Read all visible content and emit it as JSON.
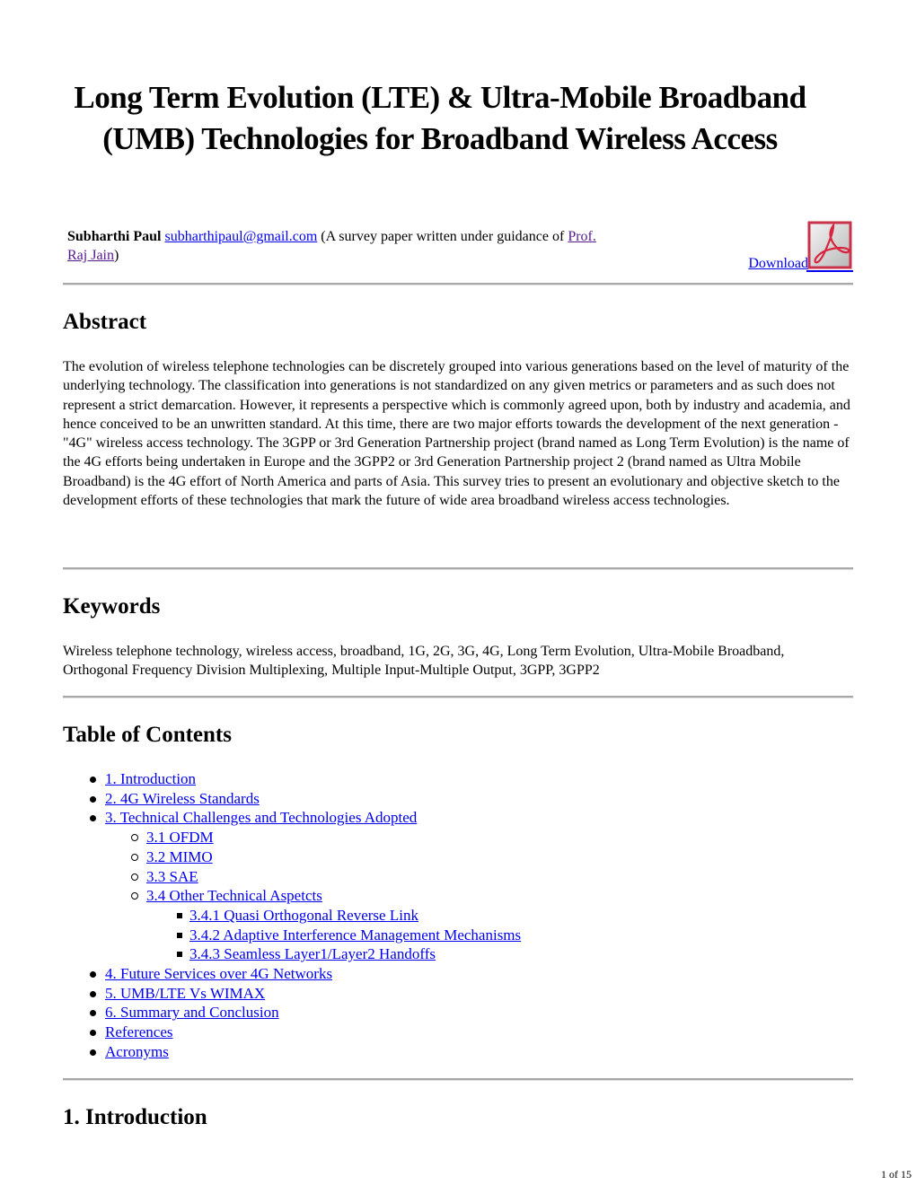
{
  "title": "Long Term Evolution (LTE) & Ultra-Mobile Broadband (UMB) Technologies for Broadband Wireless Access",
  "author": {
    "name": "Subharthi Paul",
    "email": "subharthipaul@gmail.com",
    "note_prefix": "(A survey paper written under guidance of",
    "advisor": "Prof. Raj Jain",
    "note_suffix": ")"
  },
  "download": {
    "label": "Download",
    "icon": "pdf-icon"
  },
  "sections": {
    "abstract": {
      "heading": "Abstract",
      "text": "The evolution of wireless telephone technologies can be discretely grouped into various generations based on the level of maturity of the underlying technology. The classification into generations is not standardized on any given metrics or parameters and as such does not represent a strict demarcation. However, it represents a perspective which is commonly agreed upon, both by industry and academia, and hence conceived to be an unwritten standard. At this time, there are two major efforts towards the development of the next generation - \"4G\" wireless access technology. The 3GPP or 3rd Generation Partnership project (brand named as Long Term Evolution) is the name of the 4G efforts being undertaken in Europe and the 3GPP2 or 3rd Generation Partnership project 2 (brand named as Ultra Mobile Broadband) is the 4G effort of North America and parts of Asia. This survey tries to present an evolutionary and objective sketch to the development efforts of these technologies that mark the future of wide area broadband wireless access technologies."
    },
    "keywords": {
      "heading": "Keywords",
      "text": "Wireless telephone technology, wireless access, broadband, 1G, 2G, 3G, 4G, Long Term Evolution, Ultra-Mobile Broadband, Orthogonal Frequency Division Multiplexing, Multiple Input-Multiple Output, 3GPP, 3GPP2"
    },
    "toc": {
      "heading": "Table of Contents",
      "items": [
        {
          "label": "1. Introduction",
          "level": 1
        },
        {
          "label": "2. 4G Wireless Standards",
          "level": 1
        },
        {
          "label": "3. Technical Challenges and Technologies Adopted",
          "level": 1
        },
        {
          "label": "3.1 OFDM",
          "level": 2
        },
        {
          "label": "3.2 MIMO",
          "level": 2
        },
        {
          "label": "3.3 SAE",
          "level": 2
        },
        {
          "label": "3.4 Other Technical Aspetcts",
          "level": 2
        },
        {
          "label": "3.4.1 Quasi Orthogonal Reverse Link",
          "level": 3
        },
        {
          "label": "3.4.2 Adaptive Interference Management Mechanisms",
          "level": 3
        },
        {
          "label": "3.4.3 Seamless Layer1/Layer2 Handoffs",
          "level": 3
        },
        {
          "label": "4. Future Services over 4G Networks",
          "level": 1
        },
        {
          "label": "5. UMB/LTE Vs WIMAX",
          "level": 1
        },
        {
          "label": "6. Summary and Conclusion",
          "level": 1
        },
        {
          "label": "References",
          "level": 1
        },
        {
          "label": "Acronyms",
          "level": 1
        }
      ]
    },
    "introduction": {
      "heading": "1. Introduction"
    }
  },
  "footer": {
    "page_indicator": "1 of 15"
  },
  "colors": {
    "link": "#0000ee",
    "visited_link": "#551a8b",
    "rule": "#a8a8a8"
  }
}
